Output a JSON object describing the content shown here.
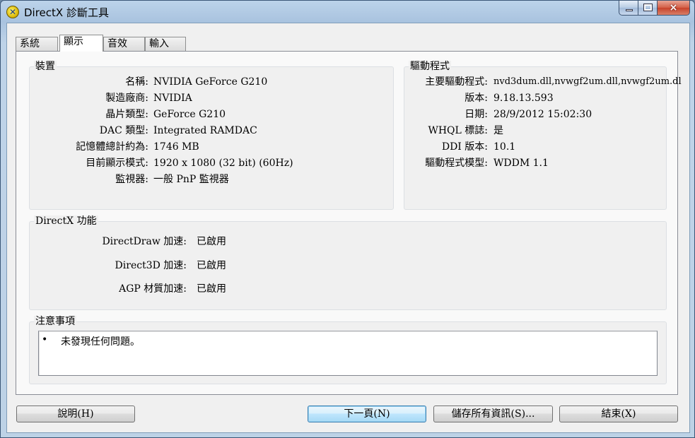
{
  "window": {
    "title": "DirectX 診斷工具",
    "icon": "directx-icon",
    "controls": {
      "minimize": "minimize-icon",
      "maximize": "maximize-icon",
      "close": "×"
    }
  },
  "tabs": [
    {
      "label": "系統",
      "active": false
    },
    {
      "label": "顯示",
      "active": true
    },
    {
      "label": "音效",
      "active": false
    },
    {
      "label": "輸入",
      "active": false
    }
  ],
  "device": {
    "title": "裝置",
    "rows": [
      {
        "label": "名稱:",
        "value": "NVIDIA GeForce G210"
      },
      {
        "label": "製造廠商:",
        "value": "NVIDIA"
      },
      {
        "label": "晶片類型:",
        "value": "GeForce G210"
      },
      {
        "label": "DAC 類型:",
        "value": "Integrated RAMDAC"
      },
      {
        "label": "記憶體總計約為:",
        "value": "1746 MB"
      },
      {
        "label": "目前顯示模式:",
        "value": "1920 x 1080 (32 bit) (60Hz)"
      },
      {
        "label": "監視器:",
        "value": "一般 PnP 監視器"
      }
    ]
  },
  "driver": {
    "title": "驅動程式",
    "rows": [
      {
        "label": "主要驅動程式:",
        "value": "nvd3dum.dll,nvwgf2um.dll,nvwgf2um.dl"
      },
      {
        "label": "版本:",
        "value": "9.18.13.593"
      },
      {
        "label": "日期:",
        "value": "28/9/2012 15:02:30"
      },
      {
        "label": "WHQL 標誌:",
        "value": "是"
      },
      {
        "label": "DDI 版本:",
        "value": "10.1"
      },
      {
        "label": "驅動程式模型:",
        "value": "WDDM 1.1"
      }
    ]
  },
  "features": {
    "title": "DirectX 功能",
    "rows": [
      {
        "label": "DirectDraw 加速:",
        "value": "已啟用"
      },
      {
        "label": "Direct3D 加速:",
        "value": "已啟用"
      },
      {
        "label": "AGP 材質加速:",
        "value": "已啟用"
      }
    ]
  },
  "notes": {
    "title": "注意事項",
    "bullet": "•",
    "text": "未發現任何問題。"
  },
  "buttons": {
    "help": "說明(H)",
    "next": "下一頁(N)",
    "save": "儲存所有資訊(S)...",
    "exit": "結束(X)"
  }
}
